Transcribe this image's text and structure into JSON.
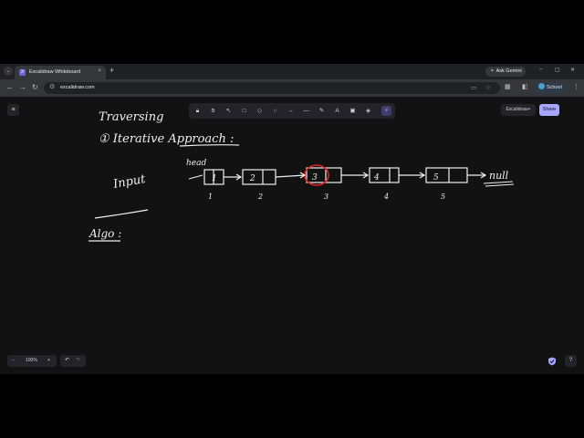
{
  "browser": {
    "tab_title": "Excalidraw Whiteboard",
    "favicon_letter": "X",
    "close_glyph": "×",
    "new_tab_glyph": "+",
    "tab_menu_glyph": "⌄",
    "ask_gemini": "Ask Gemini",
    "url": "excalidraw.com",
    "profile": "School",
    "window_controls": [
      "–",
      "▢",
      "✕"
    ]
  },
  "app": {
    "menu_glyph": "≡",
    "tools": [
      {
        "name": "lock-icon",
        "glyph": "🔒︎"
      },
      {
        "name": "hand-icon",
        "glyph": "✋︎"
      },
      {
        "name": "selection-icon",
        "glyph": "↖"
      },
      {
        "name": "rectangle-icon",
        "glyph": "□"
      },
      {
        "name": "diamond-icon",
        "glyph": "◇"
      },
      {
        "name": "ellipse-icon",
        "glyph": "○"
      },
      {
        "name": "arrow-icon",
        "glyph": "→"
      },
      {
        "name": "line-icon",
        "glyph": "—"
      },
      {
        "name": "pencil-icon",
        "glyph": "✎"
      },
      {
        "name": "text-icon",
        "glyph": "A"
      },
      {
        "name": "image-icon",
        "glyph": "▣"
      },
      {
        "name": "eraser-icon",
        "glyph": "◈"
      },
      {
        "name": "laser-icon",
        "glyph": "⚡︎"
      }
    ],
    "excalidraw_plus": "Excalidraw+",
    "share": "Share",
    "zoom": "100%",
    "zoom_out": "−",
    "zoom_in": "+",
    "undo": "↶",
    "redo": "↷",
    "help": "?"
  },
  "sketch": {
    "heading_1": "Traversing",
    "heading_2": "① Iterative Approach :",
    "input_label": "Input",
    "head_label": "head",
    "node_values": [
      "1",
      "2",
      "3",
      "4",
      "5"
    ],
    "node_indices": [
      "1",
      "2",
      "3",
      "4",
      "5"
    ],
    "null_label": "null",
    "algo_label": "Algo :"
  },
  "colors": {
    "browser_bg": "#202124",
    "canvas_bg": "#121212",
    "share_accent": "#a8a5ff",
    "highlight_red": "#e02020",
    "ink": "#f0f0f0"
  }
}
